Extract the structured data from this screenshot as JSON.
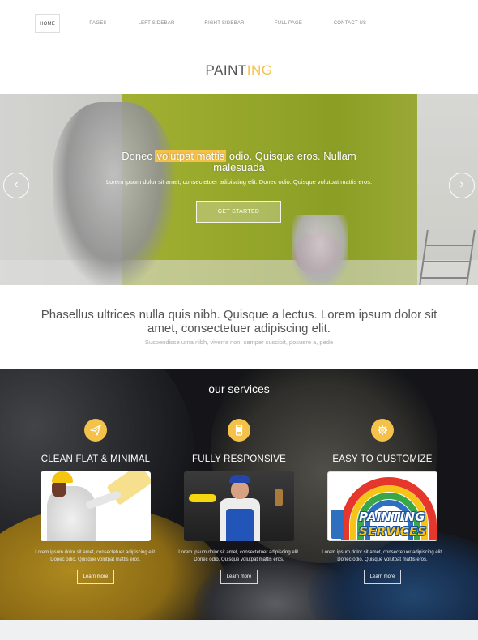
{
  "nav": {
    "items": [
      {
        "label": "HOME",
        "active": true
      },
      {
        "label": "PAGES",
        "active": false
      },
      {
        "label": "LEFT SIDEBAR",
        "active": false
      },
      {
        "label": "RIGHT SIDEBAR",
        "active": false
      },
      {
        "label": "FULL PAGE",
        "active": false
      },
      {
        "label": "CONTACT US",
        "active": false
      }
    ]
  },
  "logo": {
    "part1": "PAINT",
    "part2": "ING"
  },
  "hero": {
    "title_pre": "Donec",
    "title_highlight": "volutpat mattis",
    "title_post": "odio. Quisque eros. Nullam malesuada",
    "subtitle": "Lorem ipsum dolor sit amet, consectetuer adipiscing elit. Donec odio. Quisque volutpat mattis eros.",
    "button": "GET STARTED",
    "prev_icon": "chevron-left-icon",
    "next_icon": "chevron-right-icon"
  },
  "intro": {
    "heading": "Phasellus ultrices nulla quis nibh. Quisque a lectus. Lorem ipsum dolor sit amet, consectetuer adipiscing elit.",
    "subtext": "Suspendisse urna nibh, viverra non, semper suscipit, posuere a, pede"
  },
  "services": {
    "title": "our services",
    "items": [
      {
        "icon": "paper-plane-icon",
        "title": "CLEAN FLAT & MINIMAL",
        "text": "Lorem ipsum dolor sit amet, consectetuer adipiscing elit. Donec odio. Quisque volutpat mattis eros.",
        "button": "Learn more"
      },
      {
        "icon": "mobile-icon",
        "title": "FULLY RESPONSIVE",
        "text": "Lorem ipsum dolor sit amet, consectetuer adipiscing elit. Donec odio. Quisque volutpat mattis eros.",
        "button": "Learn more"
      },
      {
        "icon": "gear-icon",
        "title": "EASY TO CUSTOMIZE",
        "text": "Lorem ipsum dolor sit amet, consectetuer adipiscing elit. Donec odio. Quisque volutpat mattis eros.",
        "button": "Learn more",
        "image_text_1": "PAINTING",
        "image_text_2": "SERVICES"
      }
    ]
  },
  "colors": {
    "accent": "#f4c24b",
    "hero_wall": "#b9c93a",
    "services_bg": "#1c1d22"
  }
}
